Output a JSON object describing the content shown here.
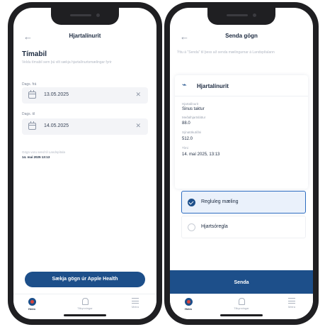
{
  "left_screen": {
    "header": {
      "back_icon": "arrow-left-icon",
      "title": "Hjartalínurit"
    },
    "section_title": "Tímabil",
    "description": "Veldu tímabil sem þú vilt sækja hjartalínurtsmælingar fyrir",
    "date_from": {
      "label": "Dags. frá",
      "value": "13.05.2025",
      "icon": "calendar-icon",
      "clear_icon": "close-icon"
    },
    "date_to": {
      "label": "Dags. til",
      "value": "14.05.2025",
      "icon": "calendar-icon",
      "clear_icon": "close-icon"
    },
    "last_sent_note": "Gögn voru send til Landspítala",
    "last_sent_date": "14. maí 2025 13:13",
    "fetch_button": "Sækja gögn úr Apple Health",
    "nav": [
      {
        "label": "Heim",
        "icon": "home-heart-icon",
        "active": true
      },
      {
        "label": "Tilkynningar",
        "icon": "bell-icon",
        "active": false
      },
      {
        "label": "Meira",
        "icon": "menu-icon",
        "active": false
      }
    ]
  },
  "right_screen": {
    "header": {
      "back_icon": "arrow-left-icon",
      "title": "Senda gögn"
    },
    "description": "Ýttu á \"Senda\" til þess að senda mælingarnar á Landspítalann",
    "card": {
      "icon": "heartbeat-icon",
      "title": "Hjartalínurit",
      "fields": [
        {
          "label": "Hjartalínurit",
          "value": "Sinus taktur"
        },
        {
          "label": "Meðalhjartsláttur",
          "value": "88.0"
        },
        {
          "label": "Sýnatökutíðni",
          "value": "512.0"
        },
        {
          "label": "Tími",
          "value": "14. maí 2025, 13:13"
        }
      ]
    },
    "options": [
      {
        "label": "Regluleg mæling",
        "selected": true
      },
      {
        "label": "Hjartsóregla",
        "selected": false
      }
    ],
    "send_button": "Senda",
    "nav": [
      {
        "label": "Heim",
        "icon": "home-heart-icon",
        "active": true
      },
      {
        "label": "Tilkynningar",
        "icon": "bell-icon",
        "active": false
      },
      {
        "label": "Meira",
        "icon": "menu-icon",
        "active": false
      }
    ]
  },
  "colors": {
    "primary": "#1d4f8a",
    "selected_bg": "#eaf1fb",
    "selected_border": "#2d6cc0",
    "phone_frame": "#1f1f22"
  }
}
